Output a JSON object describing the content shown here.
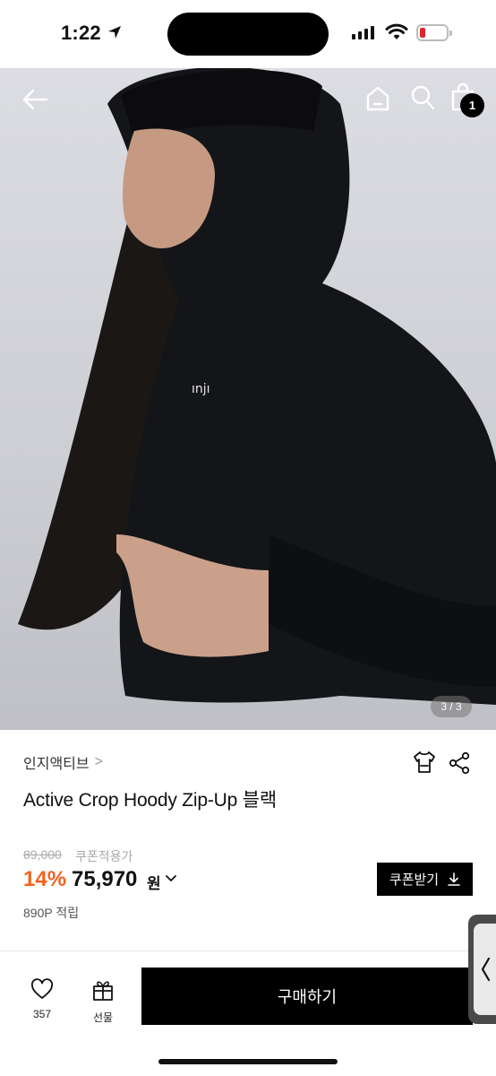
{
  "status_bar": {
    "time": "1:22"
  },
  "nav": {
    "cart_count": "1"
  },
  "hero": {
    "page_indicator": "3 / 3",
    "logo_text": "ınjı"
  },
  "product": {
    "brand": "인지액티브",
    "brand_chevron": ">",
    "title": "Active Crop Hoody Zip-Up 블랙",
    "original_price": "89,000",
    "original_price_label": "쿠폰적용가",
    "discount": "14%",
    "sale_price": "75,970",
    "currency": "원",
    "points": "890P 적립",
    "coupon_button": "쿠폰받기"
  },
  "bottom_bar": {
    "like_count": "357",
    "gift_label": "선물",
    "buy_label": "구매하기"
  },
  "colors": {
    "discount": "#f06322",
    "primary": "#000000",
    "background": "#ffffff"
  }
}
